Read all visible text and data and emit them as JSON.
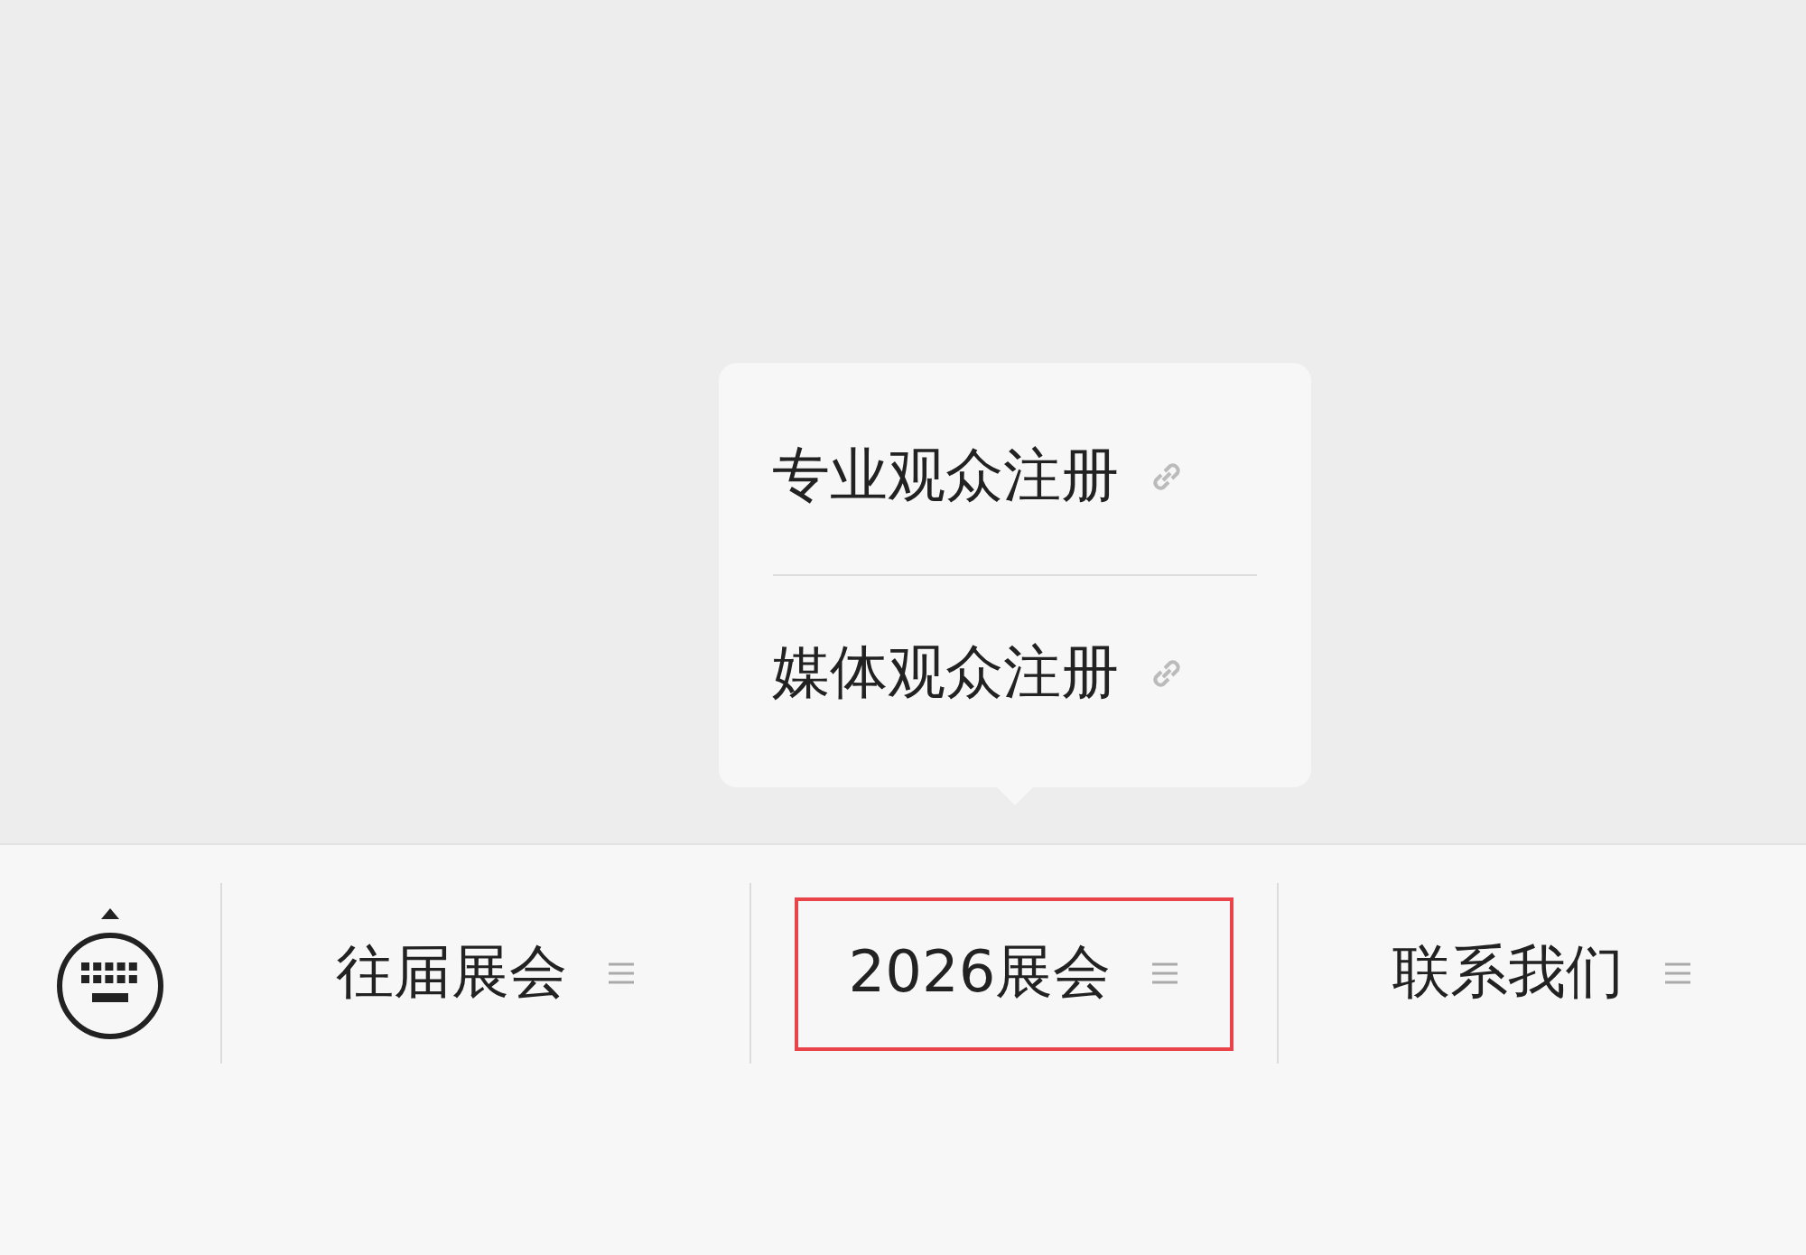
{
  "menu": {
    "items": [
      {
        "label": "往届展会",
        "highlighted": false
      },
      {
        "label": "2026展会",
        "highlighted": true,
        "submenu": [
          {
            "label": "专业观众注册"
          },
          {
            "label": "媒体观众注册"
          }
        ]
      },
      {
        "label": "联系我们",
        "highlighted": false
      }
    ]
  }
}
